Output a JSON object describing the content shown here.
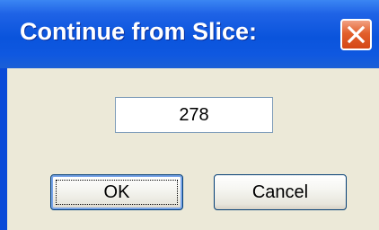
{
  "dialog": {
    "title": "Continue from Slice:",
    "close_icon": "close-x-icon",
    "value": "278",
    "ok_label": "OK",
    "cancel_label": "Cancel"
  },
  "colors": {
    "titlebar": "#0a54dc",
    "client_background": "#ece9d8",
    "close_button": "#e2602c",
    "field_border": "#7f9db9",
    "button_border": "#003c74"
  }
}
